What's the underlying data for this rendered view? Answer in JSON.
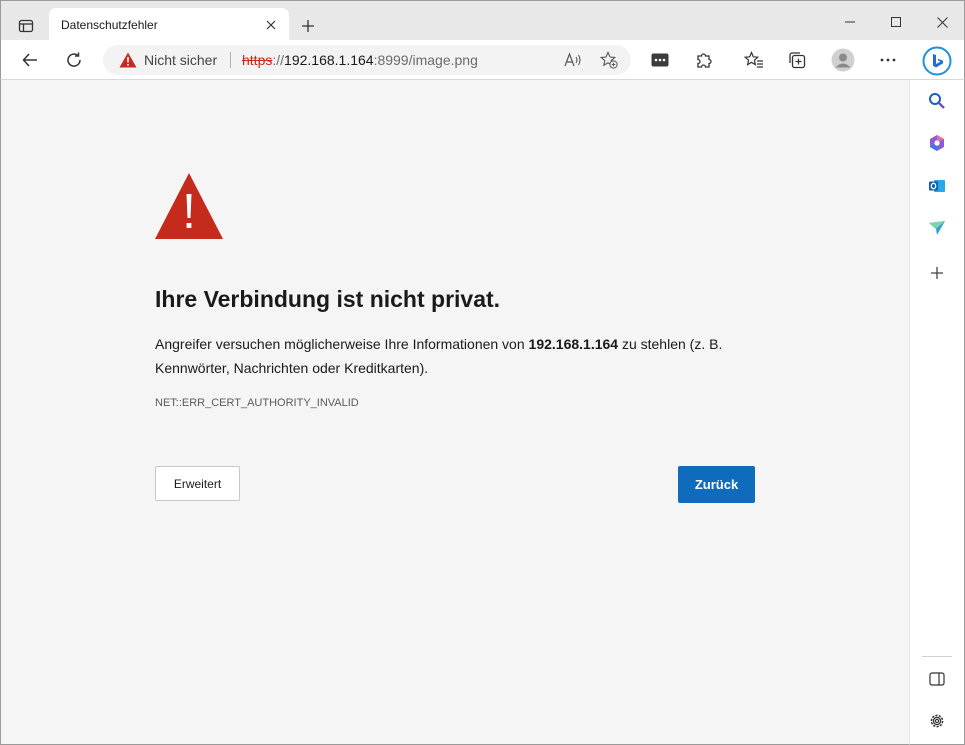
{
  "tab": {
    "title": "Datenschutzfehler"
  },
  "address_bar": {
    "security_label": "Nicht sicher",
    "url_scheme": "https",
    "url_sep": "://",
    "url_host": "192.168.1.164",
    "url_rest": ":8999/image.png"
  },
  "page": {
    "heading": "Ihre Verbindung ist nicht privat.",
    "body_before": "Angreifer versuchen möglicherweise Ihre Informationen von ",
    "body_host": "192.168.1.164",
    "body_after": " zu stehlen (z. B. Kennwörter, Nachrichten oder Kreditkarten).",
    "error_code": "NET::ERR_CERT_AUTHORITY_INVALID",
    "advanced_label": "Erweitert",
    "back_label": "Zurück"
  },
  "icons": {
    "tab_actions": "tab-actions-icon",
    "close": "close-icon",
    "new_tab": "plus-icon",
    "minimize": "minimize-icon",
    "maximize": "maximize-icon",
    "window_close": "close-icon",
    "back": "arrow-left-icon",
    "refresh": "refresh-icon",
    "warning": "warning-triangle-icon",
    "read_aloud": "read-aloud-icon",
    "add_favorite": "star-add-icon",
    "password": "password-icon",
    "extensions": "puzzle-icon",
    "favorites": "favorites-icon",
    "collections": "collections-icon",
    "profile": "avatar-icon",
    "more": "ellipsis-icon",
    "bing": "bing-icon",
    "search": "search-icon",
    "office": "office-icon",
    "outlook": "outlook-icon",
    "send": "send-icon",
    "add": "plus-icon",
    "sidebar_toggle": "sidebar-icon",
    "settings": "gear-icon"
  },
  "colors": {
    "warning_red": "#c42b1c",
    "primary_button": "#0f6cbd",
    "page_background": "#f5f5f5"
  }
}
